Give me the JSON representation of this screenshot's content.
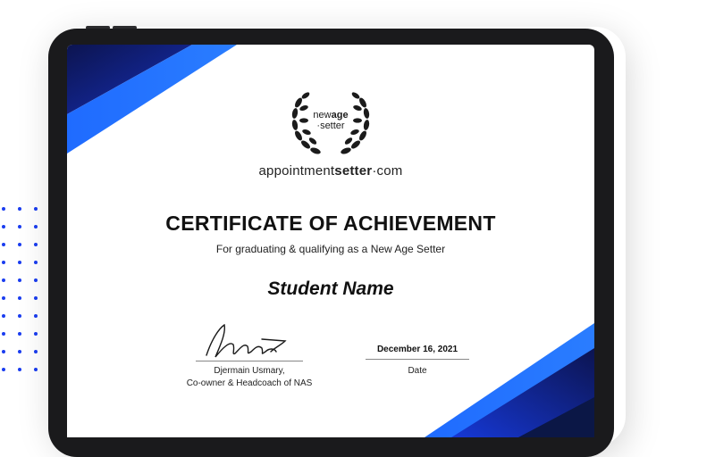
{
  "certificate": {
    "logo_word_regular": "new",
    "logo_word_bold": "age",
    "logo_word_line2": "·setter",
    "domain_regular": "appointment",
    "domain_bold": "setter",
    "domain_tail": "·com",
    "title": "CERTIFICATE OF ACHIEVEMENT",
    "subtitle": "For graduating & qualifying as a New Age Setter",
    "student_name": "Student Name",
    "signer_name": "Djermain Usmary,",
    "signer_role": "Co-owner & Headcoach of NAS",
    "date_value": "December 16, 2021",
    "date_label": "Date"
  },
  "colors": {
    "accent_blue": "#1f6bff",
    "deep_blue": "#0b1f9e",
    "navy": "#0c1450",
    "device_frame": "#1a1a1c"
  }
}
